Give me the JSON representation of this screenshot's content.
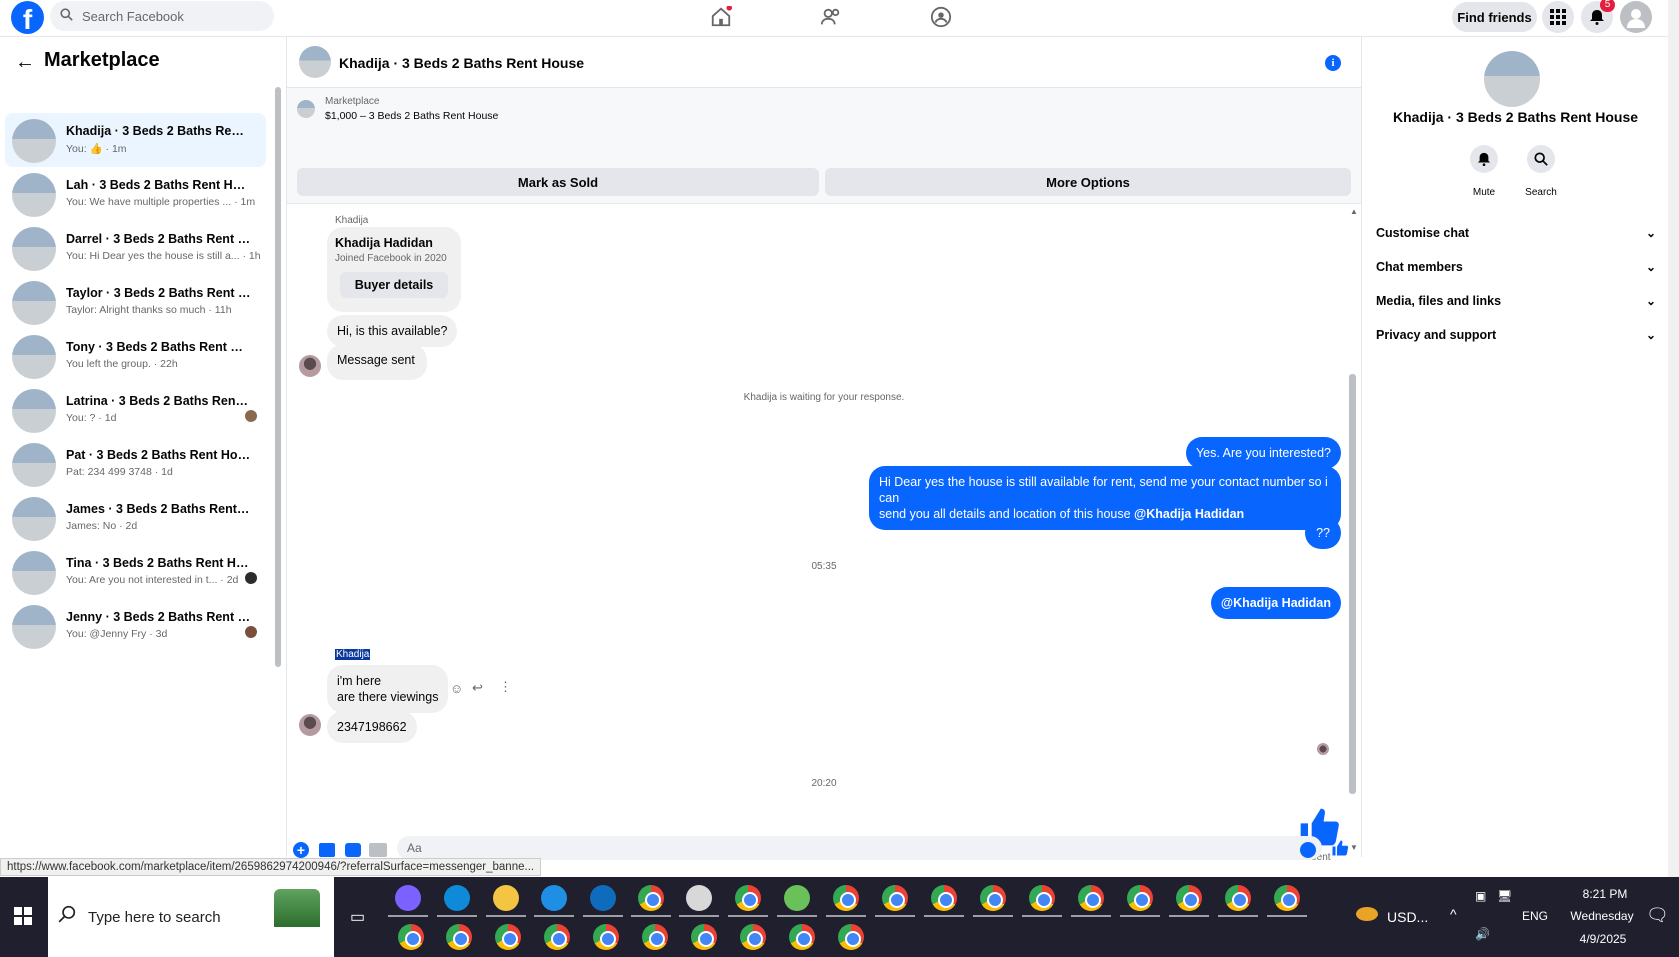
{
  "topbar": {
    "search_placeholder": "Search Facebook",
    "find_friends": "Find friends",
    "notifications_count": "5"
  },
  "left": {
    "title": "Marketplace",
    "conversations": [
      {
        "name": "Khadija · 3 Beds 2 Baths Rent H...",
        "preview": "You: 👍 · 1m",
        "active": true
      },
      {
        "name": "Lah · 3 Beds 2 Baths Rent House",
        "preview": "You: We have multiple properties ... · 1m"
      },
      {
        "name": "Darrel · 3 Beds 2 Baths Rent Ho...",
        "preview": "You: Hi Dear yes the house is still a... · 1h"
      },
      {
        "name": "Taylor · 3 Beds 2 Baths Rent Ho...",
        "preview": "Taylor: Alright thanks so much · 11h"
      },
      {
        "name": "Tony · 3 Beds 2 Baths Rent House",
        "preview": "You left the group. · 22h"
      },
      {
        "name": "Latrina · 3 Beds 2 Baths Rent ...",
        "preview": "You: ? · 1d"
      },
      {
        "name": "Pat · 3 Beds 2 Baths Rent House",
        "preview": "Pat: 234 499 3748 · 1d"
      },
      {
        "name": "James · 3 Beds 2 Baths Rent Ho...",
        "preview": "James: No · 2d"
      },
      {
        "name": "Tina · 3 Beds 2 Baths Rent Ho...",
        "preview": "You: Are you not interested in t... · 2d"
      },
      {
        "name": "Jenny · 3 Beds 2 Baths Rent H...",
        "preview": "You: @Jenny Fry · 3d"
      }
    ]
  },
  "chat": {
    "title": "Khadija · 3 Beds 2 Baths Rent House",
    "banner_label": "Marketplace",
    "banner_item": "$1,000 – 3 Beds 2 Baths Rent House",
    "mark_sold": "Mark as Sold",
    "more_options": "More Options",
    "sender_name_1": "Khadija",
    "profile_name": "Khadija Hadidan",
    "profile_joined": "Joined Facebook in 2020",
    "buyer_details": "Buyer details",
    "msg_available": "Hi, is this available?",
    "msg_sent": "Message sent",
    "waiting": "Khadija is waiting for your response.",
    "out_interested": "Yes. Are you interested?",
    "out_long_1": "Hi Dear yes the house is still available for rent, send me your contact number so i can",
    "out_long_2": "send you all details and location of this house ",
    "out_long_mention": "@Khadija Hadidan",
    "out_qq": "??",
    "time_1": "05:35",
    "out_mention": "@Khadija Hadidan",
    "sender_name_2": "Khadija",
    "in_here_1": "i'm here",
    "in_here_2": "are there viewings",
    "in_number": "2347198662",
    "time_2": "20:20",
    "sent_label": "Sent",
    "composer_placeholder": "Aa"
  },
  "right": {
    "name": "Khadija · 3 Beds 2 Baths Rent House",
    "mute": "Mute",
    "search": "Search",
    "rows": [
      "Customise chat",
      "Chat members",
      "Media, files and links",
      "Privacy and support"
    ]
  },
  "status_url": "https://www.facebook.com/marketplace/item/2659862974200946/?referralSurface=messenger_banne...",
  "taskbar": {
    "search_placeholder": "Type here to search",
    "currency": "USD...",
    "lang": "ENG",
    "time": "8:21 PM",
    "day": "Wednesday",
    "date": "4/9/2025"
  },
  "colors": {
    "accent": "#0866ff",
    "bubble_in": "#f0f0f0"
  }
}
